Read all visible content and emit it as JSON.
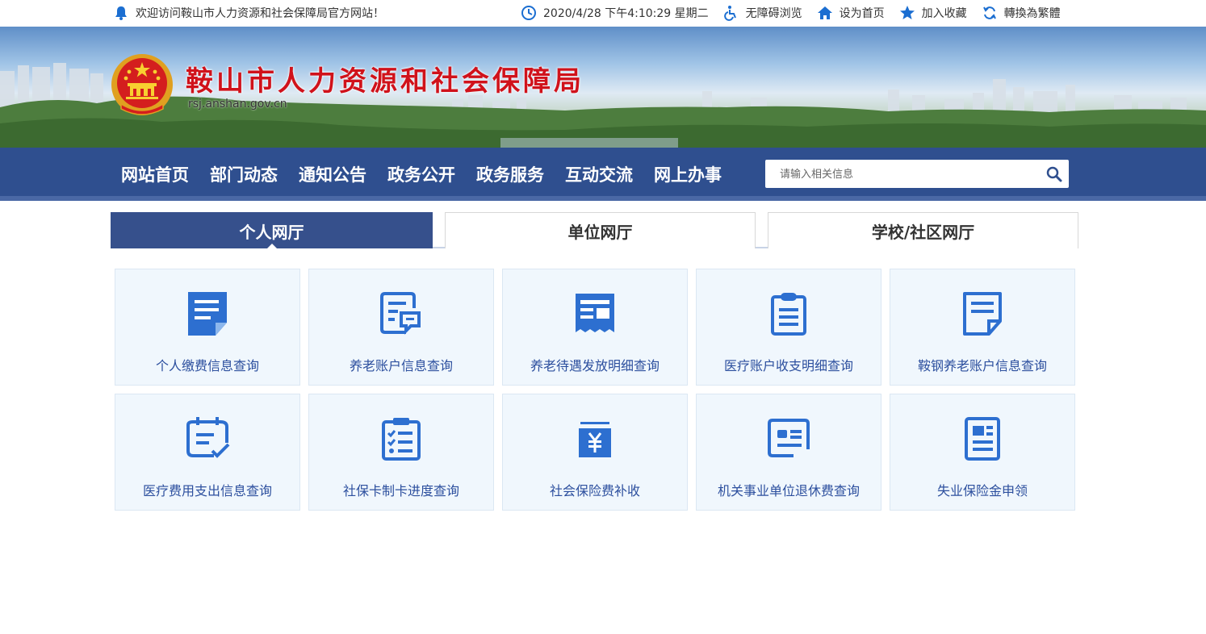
{
  "topbar": {
    "welcome": "欢迎访问鞍山市人力资源和社会保障局官方网站！",
    "datetime": "2020/4/28 下午4:10:29 星期二",
    "accessibility": "无障碍浏览",
    "set_home": "设为首页",
    "add_favorite": "加入收藏",
    "traditional": "轉換為繁體"
  },
  "header": {
    "title": "鞍山市人力资源和社会保障局",
    "domain": "rsj.anshan.gov.cn"
  },
  "nav": {
    "items": [
      "网站首页",
      "部门动态",
      "通知公告",
      "政务公开",
      "政务服务",
      "互动交流",
      "网上办事"
    ],
    "search_placeholder": "请输入相关信息"
  },
  "tabs": [
    "个人网厅",
    "单位网厅",
    "学校/社区网厅"
  ],
  "services": [
    {
      "label": "个人缴费信息查询",
      "icon": "document-icon"
    },
    {
      "label": "养老账户信息查询",
      "icon": "document-chat-icon"
    },
    {
      "label": "养老待遇发放明细查询",
      "icon": "receipt-icon"
    },
    {
      "label": "医疗账户收支明细查询",
      "icon": "clipboard-icon"
    },
    {
      "label": "鞍钢养老账户信息查询",
      "icon": "note-icon"
    },
    {
      "label": "医疗费用支出信息查询",
      "icon": "calendar-check-icon"
    },
    {
      "label": "社保卡制卡进度查询",
      "icon": "checklist-icon"
    },
    {
      "label": "社会保险费补收",
      "icon": "yuan-box-icon"
    },
    {
      "label": "机关事业单位退休费查询",
      "icon": "id-card-icon"
    },
    {
      "label": "失业保险金申领",
      "icon": "form-icon"
    }
  ],
  "colors": {
    "nav_bg": "#2f4f8f",
    "active_tab": "#36508c",
    "title_red": "#d0121b",
    "icon_blue": "#2d6fd0",
    "label_blue": "#2c4f9e"
  }
}
